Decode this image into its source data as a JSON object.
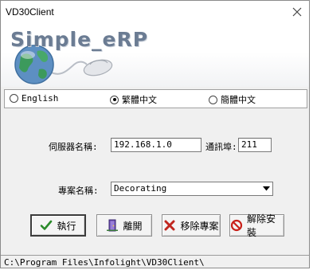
{
  "window": {
    "title": "VD30Client"
  },
  "banner": {
    "title": "Simple_eRP"
  },
  "language": {
    "options": [
      {
        "label": "English",
        "selected": false
      },
      {
        "label": "繁體中文",
        "selected": true
      },
      {
        "label": "簡體中文",
        "selected": false
      }
    ]
  },
  "server": {
    "label": "伺服器名稱:",
    "value": "192.168.1.0"
  },
  "port": {
    "label": "通訊埠:",
    "value": "211"
  },
  "project": {
    "label": "專案名稱:",
    "value": "Decorating"
  },
  "buttons": {
    "execute": "執行",
    "exit": "離開",
    "remove_project": "移除專案",
    "uninstall": "解除安裝"
  },
  "status": {
    "path": "C:\\Program Files\\Infolight\\VD30Client\\"
  },
  "colors": {
    "banner_title": "#6b7c93",
    "check_green": "#2a8a2a",
    "remove_red": "#c0261f",
    "uninstall_red": "#c8201a"
  },
  "icons": {
    "close": "close-icon",
    "logo": "globe-mouse-logo",
    "execute": "checkmark-icon",
    "exit": "door-exit-icon",
    "remove_project": "red-x-icon",
    "uninstall": "no-entry-icon",
    "dropdown": "chevron-down-icon"
  }
}
